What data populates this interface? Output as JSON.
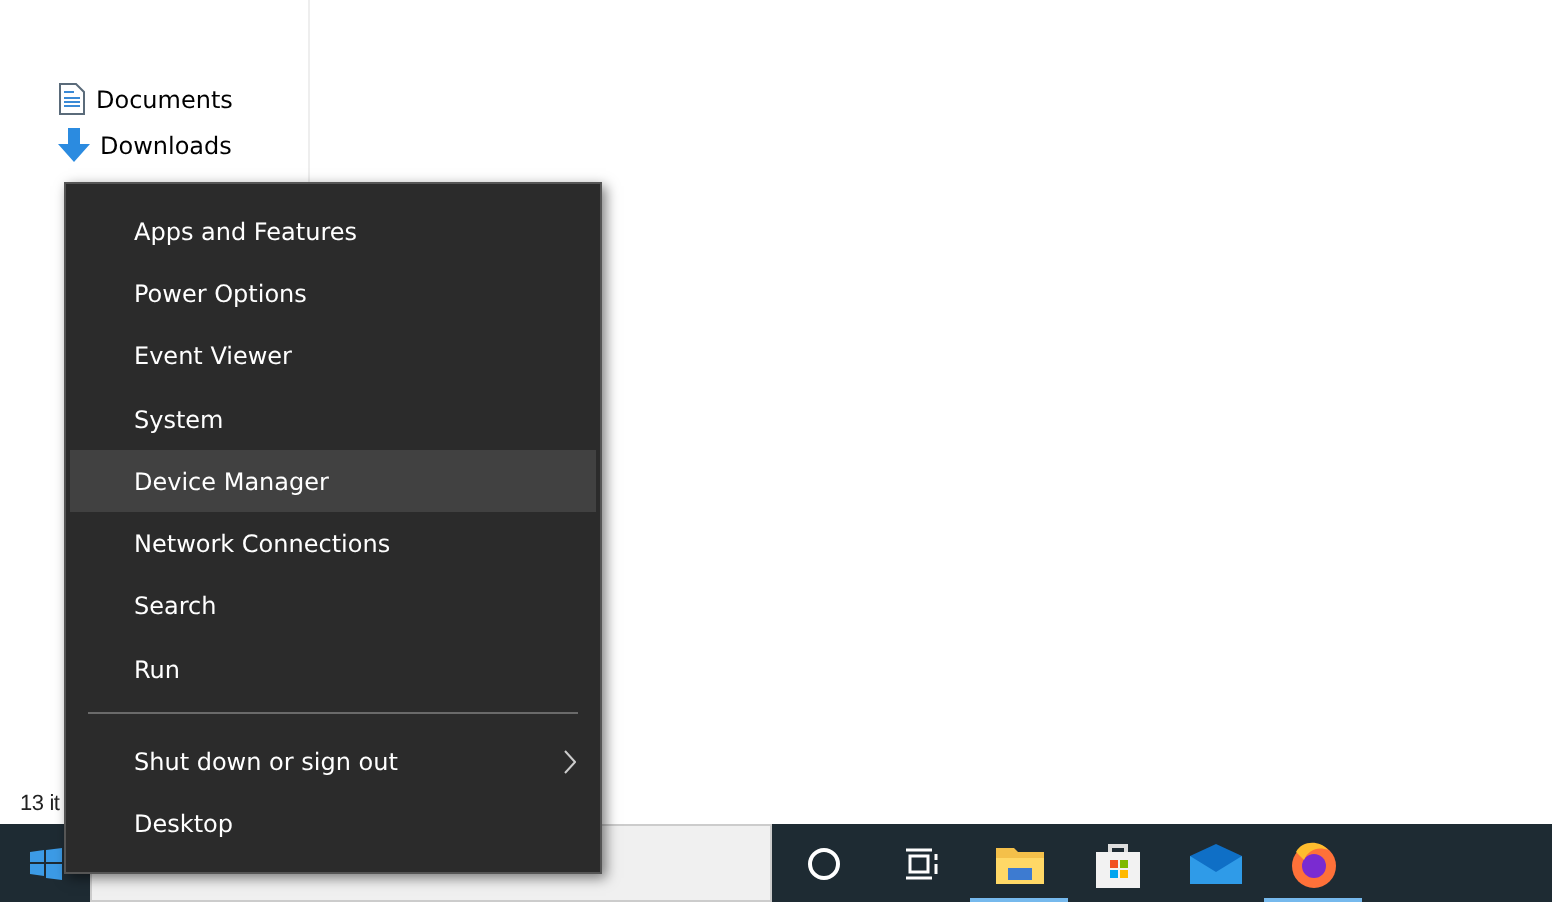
{
  "nav_items": [
    {
      "label": "Documents",
      "kind": "document"
    },
    {
      "label": "Downloads",
      "kind": "download"
    }
  ],
  "status_bar": {
    "text": "13 it"
  },
  "context_menu": {
    "items": [
      {
        "label": "Apps and Features",
        "selected": false,
        "kind": "item"
      },
      {
        "label": "Power Options",
        "selected": false,
        "kind": "item"
      },
      {
        "label": "Event Viewer",
        "selected": false,
        "kind": "item"
      },
      {
        "label": "System",
        "selected": false,
        "kind": "item"
      },
      {
        "label": "Device Manager",
        "selected": true,
        "kind": "item"
      },
      {
        "label": "Network Connections",
        "selected": false,
        "kind": "item"
      },
      {
        "label": "Search",
        "selected": false,
        "kind": "item"
      },
      {
        "label": "Run",
        "selected": false,
        "kind": "item"
      },
      {
        "kind": "separator"
      },
      {
        "label": "Shut down or sign out",
        "selected": false,
        "kind": "submenu"
      },
      {
        "label": "Desktop",
        "selected": false,
        "kind": "item"
      }
    ]
  },
  "taskbar": {
    "apps": [
      {
        "kind": "cortana",
        "running": false
      },
      {
        "kind": "taskview",
        "running": false
      },
      {
        "kind": "explorer",
        "running": true
      },
      {
        "kind": "store",
        "running": false
      },
      {
        "kind": "mail",
        "running": false
      },
      {
        "kind": "firefox",
        "running": true
      }
    ]
  }
}
